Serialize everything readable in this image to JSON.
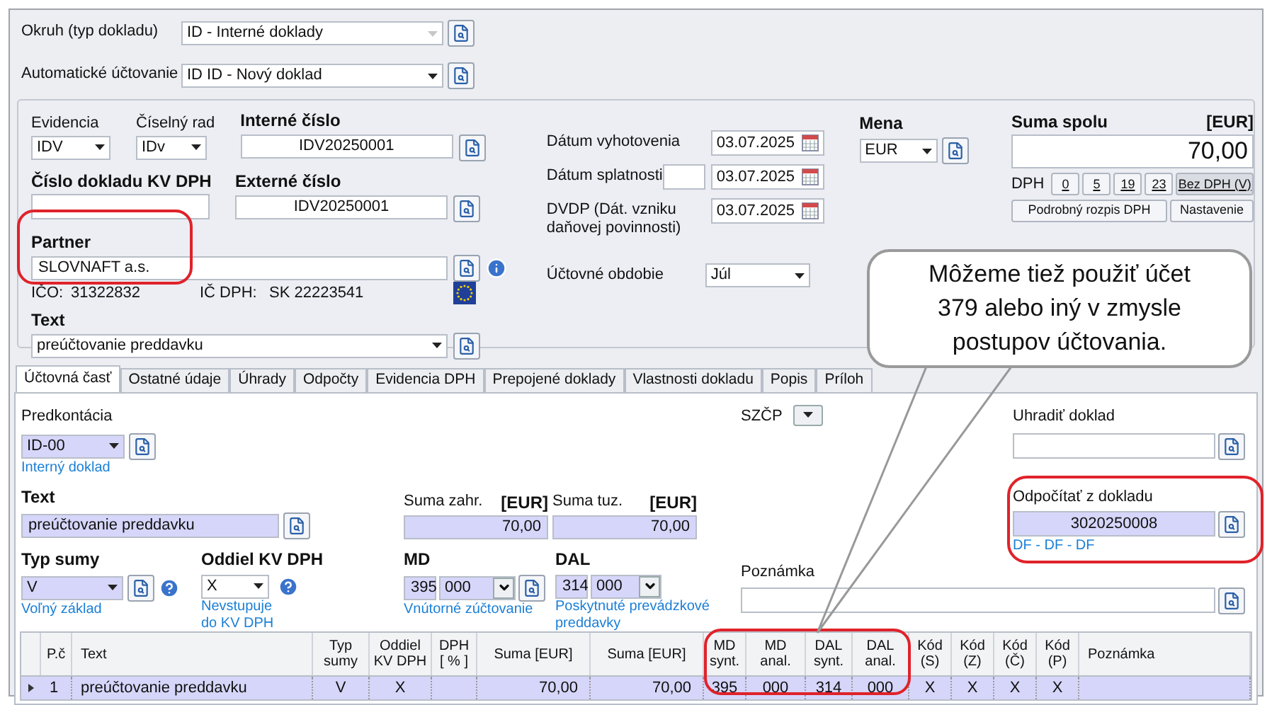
{
  "header": {
    "okruh": {
      "label": "Okruh (typ dokladu)",
      "value": "ID - Interné doklady",
      "disabled": true
    },
    "auto": {
      "label": "Automatické účtovanie",
      "value": "ID ID - Nový doklad",
      "disabled": false
    }
  },
  "document": {
    "evidencia": {
      "label": "Evidencia",
      "value": "IDV"
    },
    "ciselny_rad": {
      "label": "Číselný rad",
      "value": "IDv"
    },
    "interne_cislo": {
      "label": "Interné číslo",
      "value": "IDV20250001"
    },
    "kv_dph": {
      "label": "Číslo dokladu KV DPH"
    },
    "externe_cislo": {
      "label": "Externé číslo",
      "value": "IDV20250001"
    },
    "partner": {
      "label": "Partner",
      "value": "SLOVNAFT a.s.",
      "highlighted": true
    },
    "ico": {
      "label": "IČO:",
      "value": "31322832"
    },
    "ic_dph": {
      "label": "IČ DPH:",
      "value": "SK 22223541"
    },
    "text": {
      "label": "Text",
      "value": "preúčtovanie preddavku"
    }
  },
  "dates": [
    {
      "kind": "date",
      "label": "Dátum vyhotovenia",
      "value": "03.07.2025"
    },
    {
      "kind": "date_with_days",
      "label": "Dátum splatnosti",
      "value": "03.07.2025"
    },
    {
      "kind": "date",
      "label": "DVDP (Dát. vzniku daňovej povinnosti)",
      "value": "03.07.2025"
    }
  ],
  "period": {
    "label": "Účtovné obdobie",
    "value": "Júl"
  },
  "currency": {
    "label": "Mena",
    "value": "EUR"
  },
  "total": {
    "label": "Suma spolu",
    "unit": "[EUR]",
    "value": "70,00",
    "dph_label": "DPH",
    "rate_buttons": [
      {
        "label": "0",
        "selected": false
      },
      {
        "label": "5",
        "selected": false
      },
      {
        "label": "19",
        "selected": false
      },
      {
        "label": "23",
        "selected": false
      },
      {
        "label": "Bez DPH (V)",
        "selected": true
      }
    ],
    "buttons": [
      "Podrobný rozpis DPH",
      "Nastavenie"
    ]
  },
  "tabs": [
    {
      "label": "Účtovná časť",
      "selected": true
    },
    {
      "label": "Ostatné údaje",
      "selected": false
    },
    {
      "label": "Úhrady",
      "selected": false
    },
    {
      "label": "Odpočty",
      "selected": false
    },
    {
      "label": "Evidencia DPH",
      "selected": false
    },
    {
      "label": "Prepojené doklady",
      "selected": false
    },
    {
      "label": "Vlastnosti dokladu",
      "selected": false
    },
    {
      "label": "Popis",
      "selected": false
    },
    {
      "label": "Príloh",
      "selected": false
    }
  ],
  "accounting": {
    "predkontacia": {
      "label": "Predkontácia",
      "value": "ID-00",
      "link": "Interný doklad"
    },
    "text": {
      "label": "Text",
      "value": "preúčtovanie preddavku"
    },
    "suma_zahr": {
      "label": "Suma zahr.",
      "unit": "[EUR]",
      "value": "70,00"
    },
    "suma_tuz": {
      "label": "Suma tuz.",
      "unit": "[EUR]",
      "value": "70,00"
    },
    "typ_sumy": {
      "label": "Typ sumy",
      "value": "V",
      "link": "Voľný základ"
    },
    "oddiel": {
      "label": "Oddiel KV DPH",
      "value": "X",
      "link": "Nevstupuje\ndo KV DPH"
    },
    "md": {
      "label": "MD",
      "synt": "395",
      "anal": "000",
      "link": "Vnútorné zúčtovanie"
    },
    "dal": {
      "label": "DAL",
      "synt": "314",
      "anal": "000",
      "link": "Poskytnuté prevádzkové\npreddavky"
    },
    "szcp": {
      "label": "SZČP"
    },
    "uhradit": {
      "label": "Uhradiť doklad"
    },
    "odpocitat": {
      "label": "Odpočítať z dokladu",
      "value": "3020250008",
      "link": "DF - DF - DF",
      "highlighted": true
    },
    "poznamka": {
      "label": "Poznámka"
    }
  },
  "grid": {
    "md_dal_highlighted": true,
    "columns": [
      "P.č",
      "Text",
      "Typ\nsumy",
      "Oddiel\nKV DPH",
      "DPH\n[ % ]",
      "Suma [EUR]",
      "Suma [EUR]",
      "MD\nsynt.",
      "MD\nanal.",
      "DAL\nsynt.",
      "DAL\nanal.",
      "Kód\n(S)",
      "Kód\n(Z)",
      "Kód\n(Č)",
      "Kód\n(P)",
      "Poznámka"
    ],
    "rows": [
      {
        "selected": true,
        "cells": [
          "1",
          "preúčtovanie preddavku",
          "V",
          "X",
          "",
          "70,00",
          "70,00",
          "395",
          "000",
          "314",
          "000",
          "X",
          "X",
          "X",
          "X",
          ""
        ]
      }
    ]
  },
  "callout": {
    "text": "Môžeme tiež použiť účet 379 alebo iný v zmysle postupov účtovania."
  }
}
